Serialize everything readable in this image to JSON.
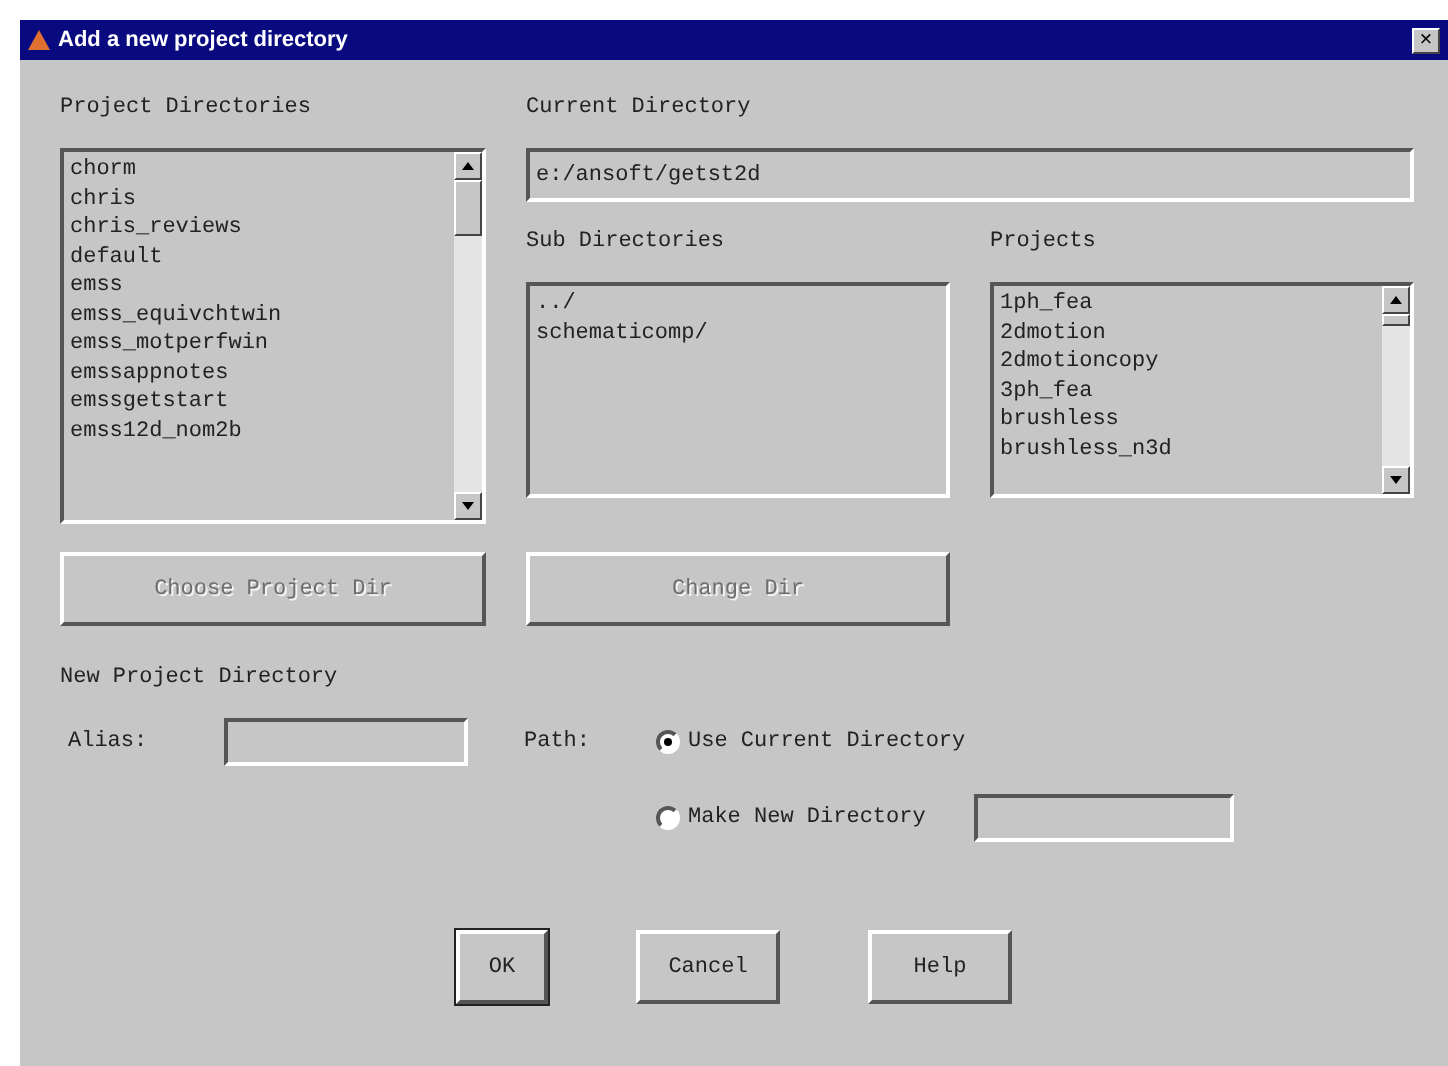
{
  "window": {
    "title": "Add a new project directory",
    "close": "×"
  },
  "project_directories": {
    "label": "Project Directories",
    "items": [
      "chorm",
      "chris",
      "chris_reviews",
      "default",
      "emss",
      "emss_equivchtwin",
      "emss_motperfwin",
      "emssappnotes",
      "emssgetstart",
      "emss12d_nom2b"
    ],
    "choose_button": {
      "label": "Choose Project Dir",
      "disabled": true
    }
  },
  "current_directory": {
    "label": "Current Directory",
    "value": "e:/ansoft/getst2d"
  },
  "sub_directories": {
    "label": "Sub Directories",
    "items": [
      "../",
      "schematicomp/"
    ],
    "change_button": {
      "label": "Change Dir",
      "disabled": true
    }
  },
  "projects": {
    "label": "Projects",
    "items": [
      "1ph_fea",
      "2dmotion",
      "2dmotioncopy",
      "3ph_fea",
      "brushless",
      "brushless_n3d"
    ]
  },
  "new_project_directory": {
    "label": "New Project Directory",
    "alias_label": "Alias:",
    "path_label": "Path:",
    "options": [
      {
        "label": "Use Current Directory",
        "selected": true,
        "has_field": false
      },
      {
        "label": "Make New Directory",
        "selected": false,
        "has_field": true
      }
    ]
  },
  "buttons": [
    {
      "label": "OK",
      "default": true
    },
    {
      "label": "Cancel",
      "default": false
    },
    {
      "label": "Help",
      "default": false
    }
  ]
}
